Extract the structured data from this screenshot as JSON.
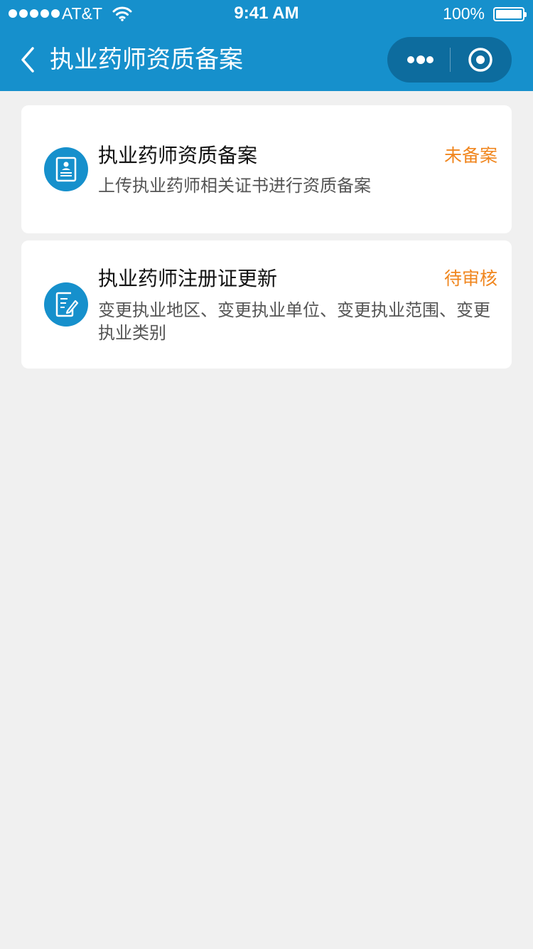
{
  "status_bar": {
    "carrier": "AT&T",
    "time": "9:41 AM",
    "battery": "100%"
  },
  "nav": {
    "title": "执业药师资质备案",
    "back_icon": "chevron-left-icon",
    "more_icon": "more-dots-icon",
    "close_icon": "target-circle-icon"
  },
  "cards": [
    {
      "title": "执业药师资质备案",
      "description": "上传执业药师相关证书进行资质备案",
      "status": "未备案",
      "icon": "certificate-document-icon"
    },
    {
      "title": "执业药师注册证更新",
      "description": "变更执业地区、变更执业单位、变更执业范围、变更执业类别",
      "status": "待审核",
      "icon": "edit-document-icon"
    }
  ],
  "colors": {
    "brand": "#1690cc",
    "capsule": "#0d6c9e",
    "status_accent": "#f0861e",
    "background": "#f0f0f0"
  }
}
